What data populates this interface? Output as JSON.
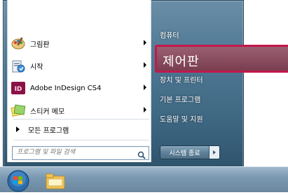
{
  "left_pane": {
    "items": [
      {
        "label": "그림판",
        "icon": "paint-icon",
        "has_arrow": true
      },
      {
        "label": "시작",
        "icon": "get-started-icon",
        "has_arrow": true
      },
      {
        "label": "Adobe InDesign CS4",
        "icon": "indesign-icon",
        "has_arrow": true
      },
      {
        "label": "스티커 메모",
        "icon": "sticky-notes-icon",
        "has_arrow": true
      }
    ],
    "all_programs": "모든 프로그램",
    "search": {
      "placeholder": "프로그램 및 파일 검색"
    }
  },
  "right_pane": {
    "items": [
      "컴퓨터",
      "제어판",
      "장치 및 프린터",
      "기본 프로그램",
      "도움말 및 지원"
    ],
    "highlighted_index": 1
  },
  "shutdown": {
    "label": "시스템 종료"
  },
  "taskbar": {
    "orb": "windows-orb-icon",
    "pinned": [
      "file-explorer-icon"
    ]
  },
  "colors": {
    "highlight_border": "#c2184c",
    "frame": "#4f7894"
  }
}
